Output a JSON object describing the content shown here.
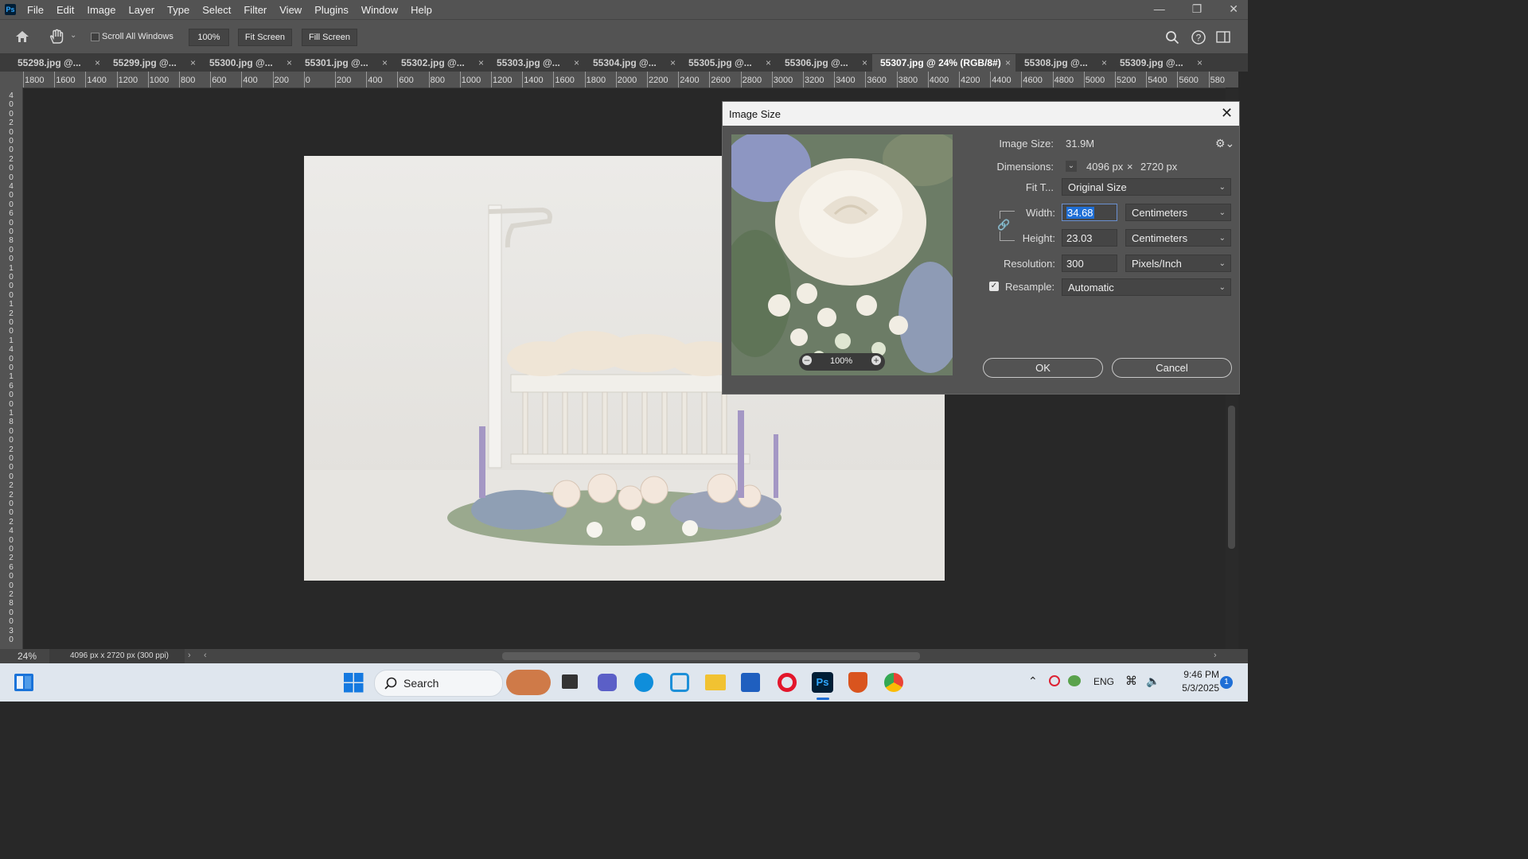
{
  "app": {
    "logo": "Ps",
    "menu": [
      "File",
      "Edit",
      "Image",
      "Layer",
      "Type",
      "Select",
      "Filter",
      "View",
      "Plugins",
      "Window",
      "Help"
    ]
  },
  "options": {
    "scroll_all_windows": "Scroll All Windows",
    "zoom_value": "100%",
    "fit_screen": "Fit Screen",
    "fill_screen": "Fill Screen"
  },
  "tabs": [
    {
      "label": "55298.jpg @..."
    },
    {
      "label": "55299.jpg @..."
    },
    {
      "label": "55300.jpg @..."
    },
    {
      "label": "55301.jpg @..."
    },
    {
      "label": "55302.jpg @..."
    },
    {
      "label": "55303.jpg @..."
    },
    {
      "label": "55304.jpg @..."
    },
    {
      "label": "55305.jpg @..."
    },
    {
      "label": "55306.jpg @..."
    },
    {
      "label": "55307.jpg @ 24% (RGB/8#)",
      "active": true
    },
    {
      "label": "55308.jpg @..."
    },
    {
      "label": "55309.jpg @..."
    }
  ],
  "ruler": {
    "h": [
      "1800",
      "1600",
      "1400",
      "1200",
      "1000",
      "800",
      "600",
      "400",
      "200",
      "0",
      "200",
      "400",
      "600",
      "800",
      "1000",
      "1200",
      "1400",
      "1600",
      "1800",
      "2000",
      "2200",
      "2400",
      "2600",
      "2800",
      "3000",
      "3200",
      "3400",
      "3600",
      "3800",
      "4000",
      "4200",
      "4400",
      "4600",
      "4800",
      "5000",
      "5200",
      "5400",
      "5600",
      "580"
    ],
    "v": [
      "4",
      "0",
      "0",
      "2",
      "0",
      "0",
      "0",
      "2",
      "0",
      "0",
      "4",
      "0",
      "0",
      "6",
      "0",
      "0",
      "8",
      "0",
      "0",
      "1",
      "0",
      "0",
      "0",
      "1",
      "2",
      "0",
      "0",
      "1",
      "4",
      "0",
      "0",
      "1",
      "6",
      "0",
      "0",
      "1",
      "8",
      "0",
      "0",
      "2",
      "0",
      "0",
      "0",
      "2",
      "2",
      "0",
      "0",
      "2",
      "4",
      "0",
      "0",
      "2",
      "6",
      "0",
      "0",
      "2",
      "8",
      "0",
      "0",
      "3",
      "0"
    ]
  },
  "status": {
    "zoom": "24%",
    "doc_info": "4096 px x 2720 px (300 ppi)"
  },
  "dialog": {
    "title": "Image Size",
    "preview_zoom": "100%",
    "image_size_label": "Image Size:",
    "image_size_value": "31.9M",
    "dimensions_label": "Dimensions:",
    "dim_width": "4096 px",
    "dim_x": "×",
    "dim_height": "2720 px",
    "fit_label": "Fit T...",
    "fit_value": "Original Size",
    "width_label": "Width:",
    "width_value": "34.68",
    "width_unit": "Centimeters",
    "height_label": "Height:",
    "height_value": "23.03",
    "height_unit": "Centimeters",
    "resolution_label": "Resolution:",
    "resolution_value": "300",
    "resolution_unit": "Pixels/Inch",
    "resample_label": "Resample:",
    "resample_value": "Automatic",
    "ok": "OK",
    "cancel": "Cancel"
  },
  "taskbar": {
    "search": "Search",
    "lang": "ENG",
    "time": "9:46 PM",
    "date": "5/3/2025",
    "notif_count": "1"
  },
  "colors": {
    "accent_blue": "#2d6be0",
    "ps_blue": "#31a8ff",
    "selection_blue": "#1f6fd6"
  }
}
